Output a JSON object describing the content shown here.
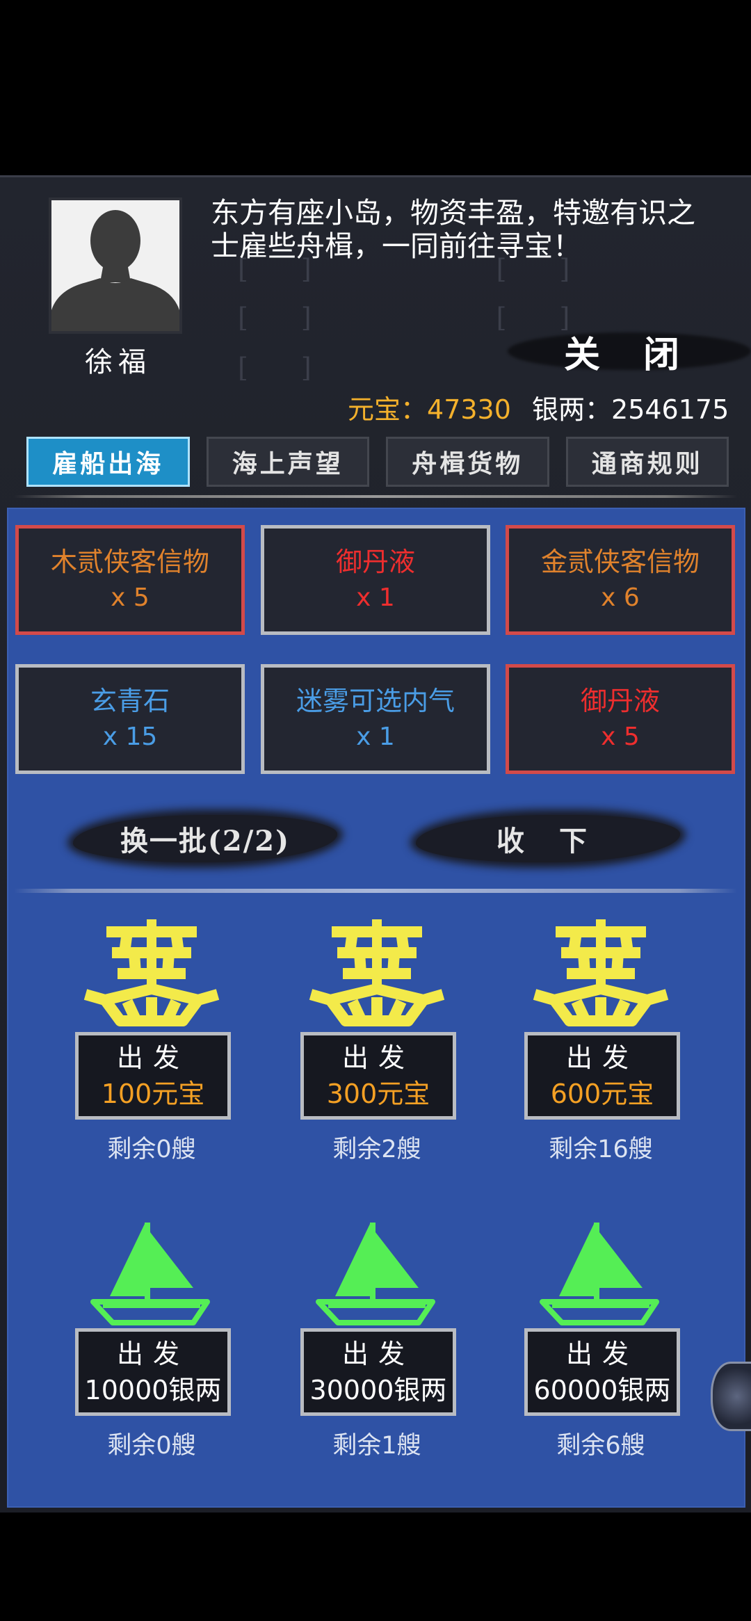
{
  "npc": {
    "name": "徐福",
    "dialog": "东方有座小岛，物资丰盈，特邀有识之士雇些舟楫，一同前往寻宝！"
  },
  "close_label": "关 闭",
  "currency": {
    "yuanbao_label": "元宝：",
    "yuanbao_value": "47330",
    "silver_label": "银两：",
    "silver_value": "2546175"
  },
  "tabs": [
    {
      "label": "雇船出海",
      "active": true
    },
    {
      "label": "海上声望",
      "active": false
    },
    {
      "label": "舟楫货物",
      "active": false
    },
    {
      "label": "通商规则",
      "active": false
    }
  ],
  "rewards": [
    {
      "name": "木贰侠客信物",
      "qty": "x 5",
      "color": "#e0822c",
      "border": "red"
    },
    {
      "name": "御丹液",
      "qty": "x 1",
      "color": "#ee2e2e",
      "border": "silver"
    },
    {
      "name": "金贰侠客信物",
      "qty": "x 6",
      "color": "#e0822c",
      "border": "red"
    },
    {
      "name": "玄青石",
      "qty": "x 15",
      "color": "#4a9de6",
      "border": "silver"
    },
    {
      "name": "迷雾可选内气",
      "qty": "x 1",
      "color": "#4a9de6",
      "border": "silver"
    },
    {
      "name": "御丹液",
      "qty": "x 5",
      "color": "#ee2e2e",
      "border": "red"
    }
  ],
  "actions": {
    "refresh_label": "换一批(2/2)",
    "collect_label": "收 下"
  },
  "big_ships": [
    {
      "go_label": "出发",
      "cost": "100元宝",
      "remaining": "剩余0艘"
    },
    {
      "go_label": "出发",
      "cost": "300元宝",
      "remaining": "剩余2艘"
    },
    {
      "go_label": "出发",
      "cost": "600元宝",
      "remaining": "剩余16艘"
    }
  ],
  "small_boats": [
    {
      "go_label": "出发",
      "cost": "10000银两",
      "remaining": "剩余0艘"
    },
    {
      "go_label": "出发",
      "cost": "30000银两",
      "remaining": "剩余1艘"
    },
    {
      "go_label": "出发",
      "cost": "60000银两",
      "remaining": "剩余6艘"
    }
  ],
  "icons": {
    "big_ship": "junk-ship-icon",
    "small_boat": "sailboat-icon"
  },
  "colors": {
    "big_ship": "#f3ea4a",
    "small_boat": "#55ee55",
    "sea": "#2f52a5",
    "active_tab": "#1e8fc7",
    "gold_text": "#f4a024"
  }
}
